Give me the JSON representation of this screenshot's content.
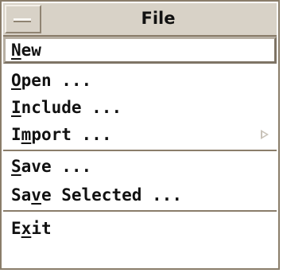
{
  "window": {
    "title": "File"
  },
  "menu": {
    "items": [
      {
        "prefix": "",
        "mnemonic": "N",
        "suffix": "ew"
      },
      {
        "prefix": "",
        "mnemonic": "O",
        "suffix": "pen ..."
      },
      {
        "prefix": "",
        "mnemonic": "I",
        "suffix": "nclude ..."
      },
      {
        "prefix": "I",
        "mnemonic": "m",
        "suffix": "port ...",
        "submenu_icon": "submenu-arrow-icon"
      },
      {
        "prefix": "",
        "mnemonic": "S",
        "suffix": "ave ..."
      },
      {
        "prefix": "Sa",
        "mnemonic": "v",
        "suffix": "e Selected ..."
      },
      {
        "prefix": "E",
        "mnemonic": "x",
        "suffix": "it"
      }
    ]
  },
  "colors": {
    "titlebar_bg": "#d8d2c7",
    "border": "#8a7d6a",
    "text": "#111111",
    "menu_bg": "#ffffff"
  }
}
